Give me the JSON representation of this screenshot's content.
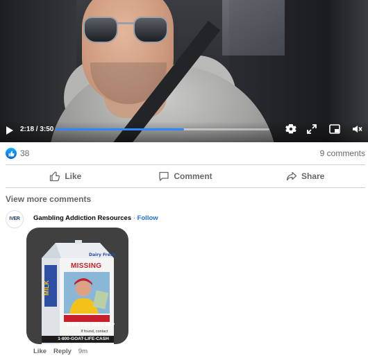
{
  "video": {
    "current_time": "2:18",
    "duration": "3:50",
    "time_label": "2:18 / 3:50",
    "progress_fraction": 0.6,
    "accent_color": "#2d88ff",
    "controls": [
      "play-icon",
      "gear-icon",
      "expand-icon",
      "pip-icon",
      "volume-muted-icon"
    ]
  },
  "reactions": {
    "icon": "thumbs-up-icon",
    "count": "38",
    "comments": "9 comments"
  },
  "actions": {
    "like": "Like",
    "comment": "Comment",
    "share": "Share"
  },
  "view_more": "View more comments",
  "comment": {
    "author": "Gambling Addiction Resources",
    "separator": " · ",
    "follow": "Follow",
    "avatar_text": "IVER",
    "sticker": {
      "header_small": "Dairy Fresh",
      "missing": "MISSING",
      "side_text": "MILK",
      "have_you_seen": "HAVE YOU SEEN ME?",
      "if_found": "If found, contact",
      "phone": "1-800-GOAT-LIFE-CASH"
    },
    "like": "Like",
    "reply": "Reply",
    "time": "9m"
  }
}
